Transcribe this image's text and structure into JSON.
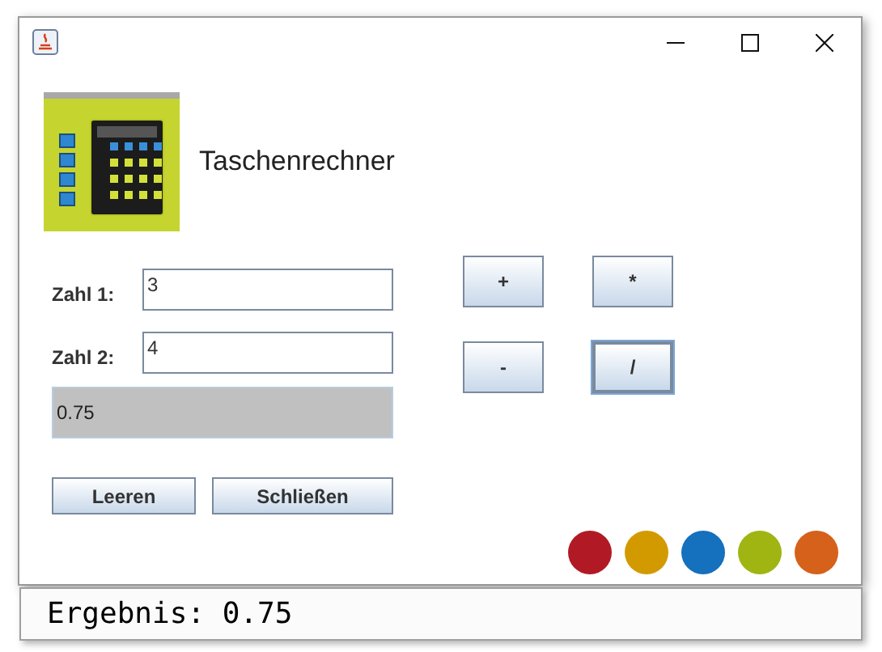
{
  "header": {
    "title": "Taschenrechner"
  },
  "fields": [
    {
      "label": "Zahl 1:",
      "value": "3"
    },
    {
      "label": "Zahl 2:",
      "value": "4"
    }
  ],
  "result": "0.75",
  "actions": [
    "Leeren",
    "Schließen"
  ],
  "operators": [
    {
      "label": "+",
      "focused": false
    },
    {
      "label": "*",
      "focused": false
    },
    {
      "label": "-",
      "focused": false
    },
    {
      "label": "/",
      "focused": true
    }
  ],
  "dots": [
    {
      "color": "#b11a25"
    },
    {
      "color": "#d39a00"
    },
    {
      "color": "#1570bd"
    },
    {
      "color": "#a0b512"
    },
    {
      "color": "#d5611a"
    }
  ],
  "console": {
    "text": "Ergebnis: 0.75"
  }
}
